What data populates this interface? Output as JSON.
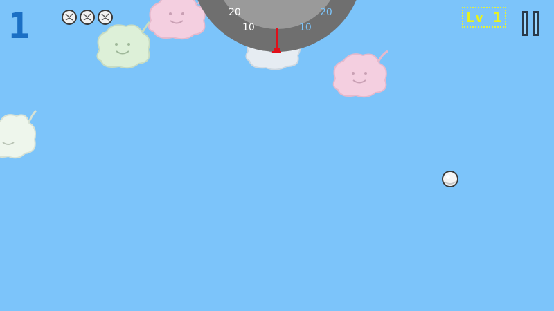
{
  "hud": {
    "score": "1",
    "lives": [
      {
        "icon": "life-ball-icon"
      },
      {
        "icon": "life-ball-icon"
      },
      {
        "icon": "life-ball-icon"
      }
    ],
    "level_label": "Lv 1",
    "pause_icon": "pause-icon"
  },
  "gauge": {
    "tick_labels": {
      "left_outer": "20",
      "left_inner": "10",
      "right_inner": "10",
      "right_outer": "20"
    },
    "needle_color": "#e0101a",
    "ring_color": "#6f6f6f",
    "inner_color": "#9a9a9a"
  },
  "clouds": [
    {
      "name": "cloud-pink-top",
      "color": "#f4cfe0"
    },
    {
      "name": "cloud-mint",
      "color": "#ddf0d8"
    },
    {
      "name": "cloud-white-center",
      "color": "#e6ecf2"
    },
    {
      "name": "cloud-pink-right",
      "color": "#f4cfe0"
    },
    {
      "name": "cloud-white-left",
      "color": "#eef6ec"
    }
  ],
  "colors": {
    "sky": "#7cc4fa",
    "score": "#1b6fc4",
    "level": "#e8f21c"
  }
}
